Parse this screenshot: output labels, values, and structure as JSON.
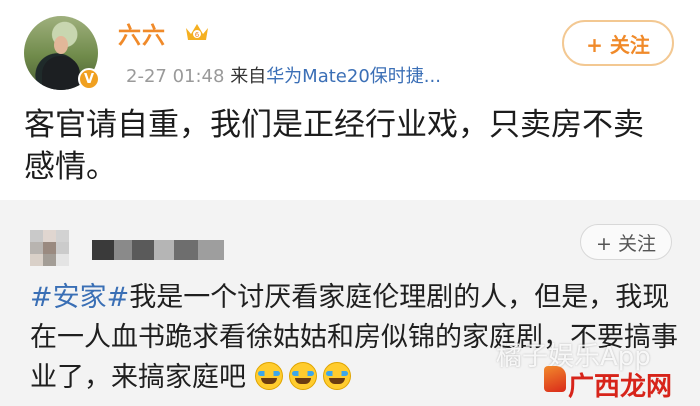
{
  "post": {
    "username": "六六",
    "timestamp": "2-27 01:48",
    "source_prefix": "来自",
    "device": "华为Mate20保时捷...",
    "follow_label": "+ 关注",
    "text": "客官请自重，我们是正经行业戏，只卖房不卖感情。",
    "verified_badge": "V",
    "colors": {
      "username": "#f08a2a",
      "link": "#3b6fb6"
    }
  },
  "repost": {
    "follow_label": "+ 关注",
    "hashtag": "#安家#",
    "text": "我是一个讨厌看家庭伦理剧的人，但是，我现在一人血书跪求看徐姑姑和房似锦的家庭剧，不要搞事业了，来搞家庭吧",
    "emojis": [
      "crying-laughing-emoji",
      "crying-laughing-emoji",
      "crying-laughing-emoji"
    ]
  },
  "watermarks": {
    "top": "橘子娱乐App",
    "bottom": "广西龙网"
  }
}
